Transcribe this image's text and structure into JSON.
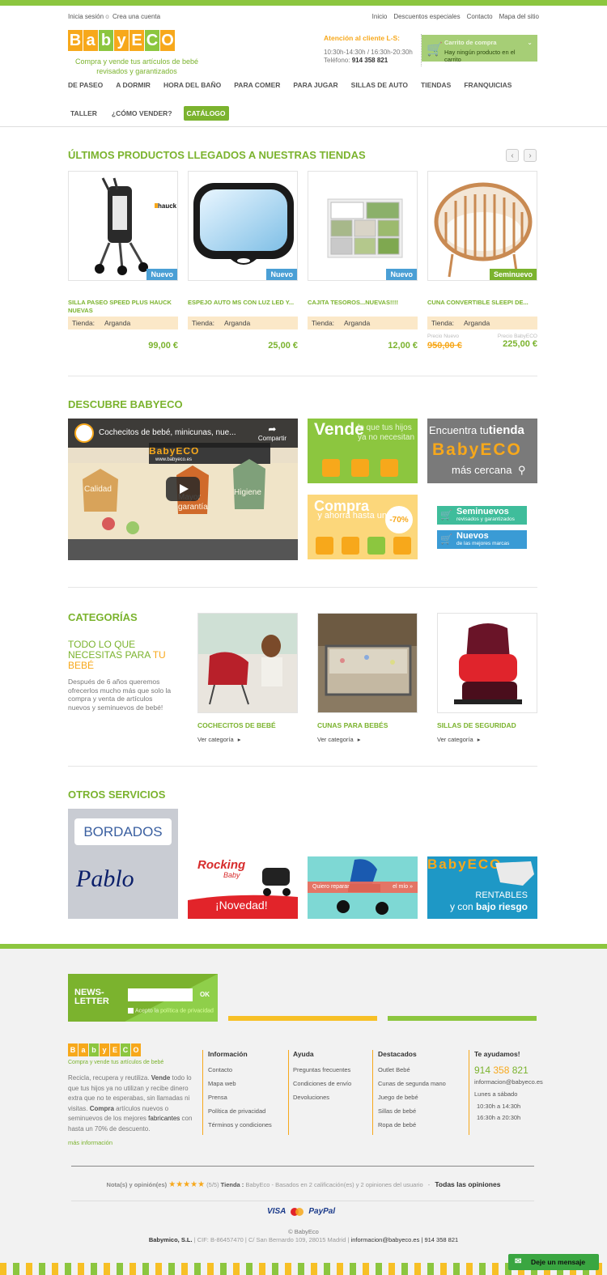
{
  "header": {
    "login": "Inicia sesión",
    "or": "o",
    "register": "Crea una cuenta",
    "top_links": [
      "Inicio",
      "Descuentos especiales",
      "Contacto",
      "Mapa del sitio"
    ],
    "logo_letters": [
      "B",
      "a",
      "b",
      "y",
      "E",
      "C",
      "O"
    ],
    "logo_colors": [
      "#f7a81b",
      "#f7a81b",
      "#8cc63f",
      "#f7a81b",
      "#f7a81b",
      "#8cc63f",
      "#f7a81b"
    ],
    "tagline_1": "Compra y vende tus artículos de bebé",
    "tagline_2": "revisados y garantizados",
    "attention_title": "Atención al cliente L-S:",
    "attention_hours": "10:30h-14:30h / 16:30h-20:30h",
    "phone_label": "Teléfono:",
    "phone": "914 358 821",
    "cart_title": "Carrito de compra",
    "cart_empty": "Hay ningún producto en el carrito"
  },
  "nav": {
    "row1": [
      "DE PASEO",
      "A DORMIR",
      "HORA DEL BAÑO",
      "PARA COMER",
      "PARA JUGAR",
      "SILLAS DE AUTO",
      "TIENDAS",
      "FRANQUICIAS"
    ],
    "row2": [
      "TALLER",
      "¿CÓMO VENDER?",
      "CATÁLOGO"
    ]
  },
  "latest": {
    "title": "ÚLTIMOS PRODUCTOS LLEGADOS A NUESTRAS TIENDAS",
    "prev": "‹",
    "next": "›",
    "tienda_label": "Tienda:",
    "products": [
      {
        "name": "SILLA PASEO SPEED PLUS HAUCK NUEVAS",
        "badge": "Nuevo",
        "store": "Arganda",
        "price": "99,00 €",
        "brand": "hauck"
      },
      {
        "name": "ESPEJO AUTO MS CON LUZ LED Y...",
        "badge": "Nuevo",
        "store": "Arganda",
        "price": "25,00 €"
      },
      {
        "name": "CAJITA TESOROS...NUEVAS!!!!",
        "badge": "Nuevo",
        "store": "Arganda",
        "price": "12,00 €"
      },
      {
        "name": "CUNA CONVERTIBLE SLEEPI DE...",
        "badge": "Seminuevo",
        "store": "Arganda",
        "old_label": "Precio Nuevo",
        "old_price": "950,00 €",
        "new_label": "Precio BabyECO",
        "price": "225,00 €"
      }
    ]
  },
  "discover": {
    "title": "DESCUBRE BABYECO",
    "video_title": "Cochecitos de bebé, minicunas, nue...",
    "video_share": "Compartir",
    "video_sign": "BabyECO",
    "video_url": "www.babyeco.es",
    "video_tags": [
      "Calidad",
      "Mayor garantía",
      "Higiene"
    ],
    "vende_big": "Vende",
    "vende_small": "lo que tus hijos ya no necesitan",
    "compra_big": "Compra",
    "compra_small": "y ahorra hasta un",
    "compra_pct": "-70%",
    "encuentra_1": "Encuentra tu",
    "encuentra_2": "tienda",
    "encuentra_logo": "BabyECO",
    "encuentra_3": "más cercana",
    "semi_title": "Seminuevos",
    "semi_sub": "revisados y garantizados",
    "nuevos_title": "Nuevos",
    "nuevos_sub": "de las mejores marcas"
  },
  "categories": {
    "title": "CATEGORÍAS",
    "lead_1": "TODO LO QUE NECESITAS PARA",
    "lead_2": "TU BEBÉ",
    "text": "Después de 6 años queremos ofrecerlos mucho más que solo la compra y venta de artículos nuevos y seminuevos de bebé!",
    "link": "Ver categoría",
    "items": [
      "COCHECITOS DE BEBÉ",
      "CUNAS PARA BEBÉS",
      "SILLAS DE SEGURIDAD"
    ]
  },
  "services": {
    "title": "OTROS SERVICIOS",
    "bordados": "BORDADOS",
    "pablo": "Pablo",
    "rocking_1": "Rocking",
    "rocking_2": "Baby",
    "novedad": "¡Novedad!",
    "reparar": "Quiero reparar",
    "mio": "el mío »",
    "franq_logo": "BabyECO",
    "rentables": "RENTABLES",
    "riesgo_1": "y con",
    "riesgo_2": "bajo riesgo"
  },
  "footer": {
    "news_1": "NEWS-",
    "news_2": "LETTER",
    "ok": "OK",
    "accept_1": "Acepto la",
    "accept_2": "política de privacidad",
    "logo_tagline": "Compra y vende tus artículos de bebé",
    "about_1": "Recicla, recupera y reutiliza.",
    "about_vende": "Vende",
    "about_2": "todo lo que tus hijos ya no utilizan y recibe dinero extra que no te esperabas, sin llamadas ni visitas.",
    "about_compra": "Compra",
    "about_3": "artículos nuevos o seminuevos de los mejores",
    "about_fab": "fabricantes",
    "about_4": "con hasta un 70% de descuento.",
    "more": "más información",
    "info_title": "Información",
    "info": [
      "Contacto",
      "Mapa web",
      "Prensa",
      "Política de privacidad",
      "Términos y condiciones"
    ],
    "help_title": "Ayuda",
    "help": [
      "Preguntas frecuentes",
      "Condiciones de envío",
      "Devoluciones"
    ],
    "feat_title": "Destacados",
    "feat": [
      "Outlet Bebé",
      "Cunas de segunda mano",
      "Juego de bebé",
      "Sillas de bebé",
      "Ropa de bebé"
    ],
    "contact_title": "Te ayudamos!",
    "phone_a": "914",
    "phone_b": "358",
    "phone_c": "821",
    "email": "informacion@babyeco.es",
    "days": "Lunes a sábado",
    "h1": "10:30h a 14:30h",
    "h2": "16:30h a 20:30h",
    "rating_label": "Nota(s) y opinión(es)",
    "stars": "★★★★★",
    "rating_score": "(5/5)",
    "rating_store_label": "Tienda :",
    "rating_text": "BabyEco - Basados en 2 calificación(es) y 2 opiniones del usuario",
    "dash": "-",
    "all_reviews": "Todas las opiniones",
    "pay_visa": "VISA",
    "pay_paypal": "PayPal",
    "copyright": "© BabyEco",
    "legal_company": "Babymico, S.L.",
    "legal_rest": "| CIF: B-86457470 | C/ San Bernardo 109, 28015 Madrid |",
    "legal_email": "informacion@babyeco.es",
    "legal_phone": "| 914 358 821",
    "chat": "Deje un mensaje"
  }
}
